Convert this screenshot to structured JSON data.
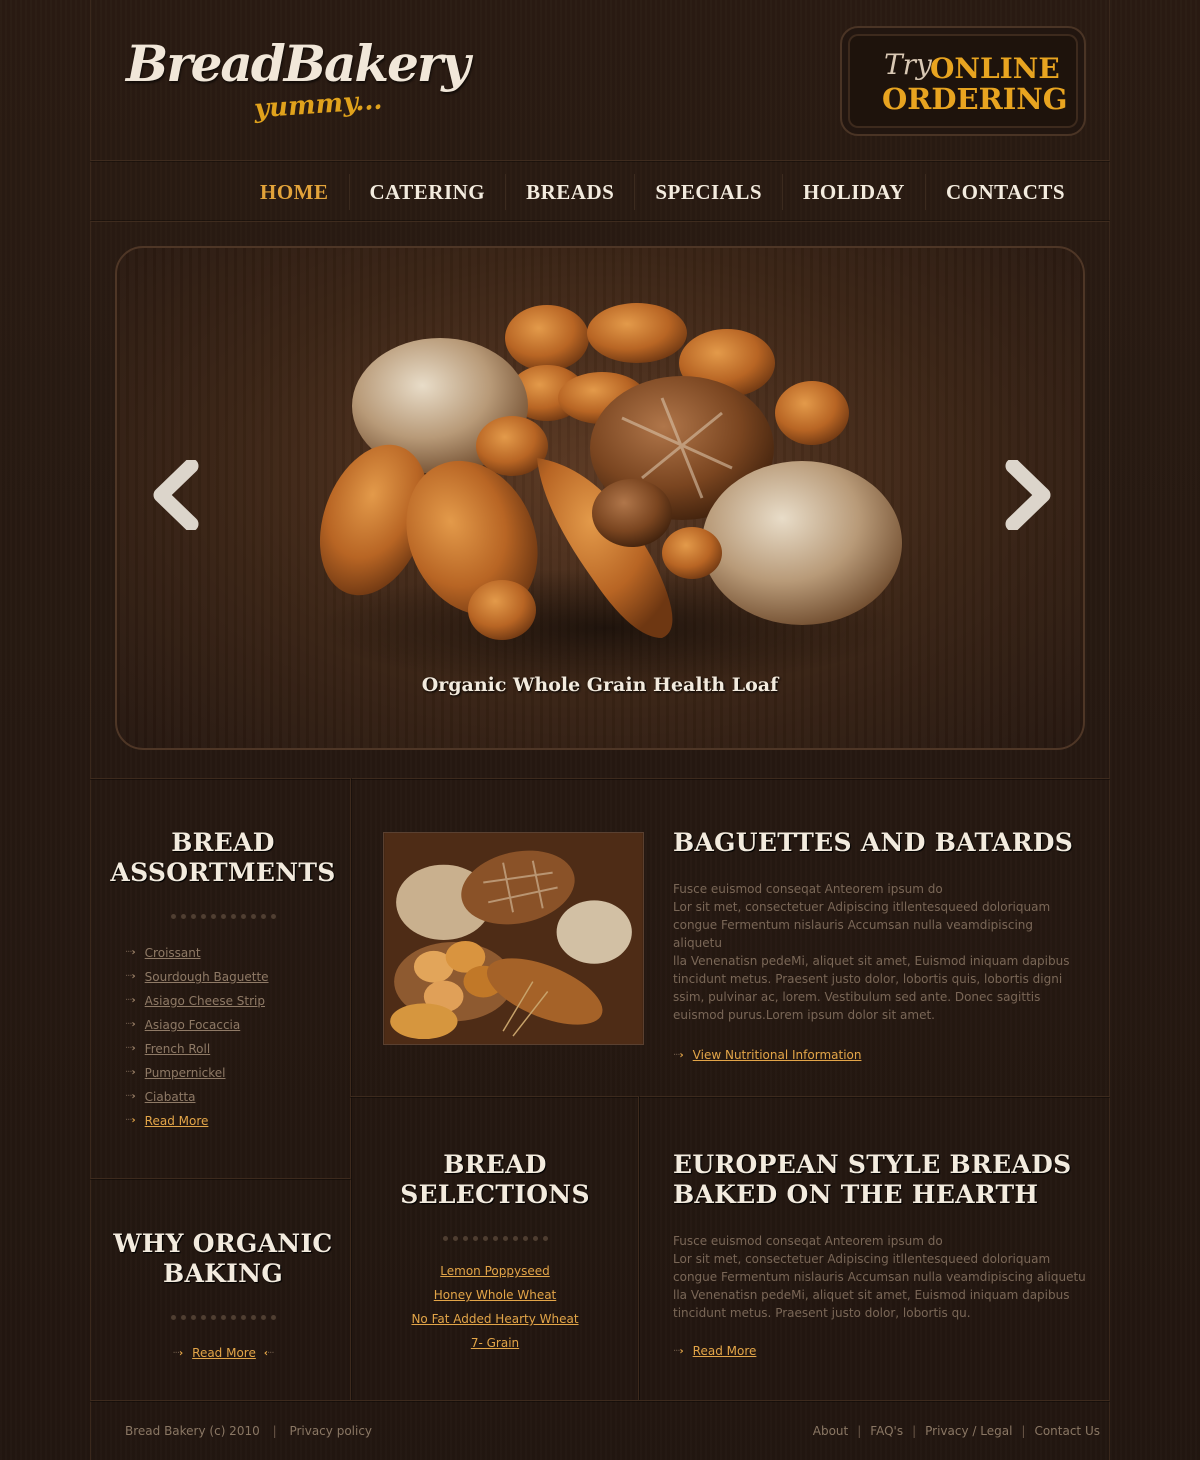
{
  "header": {
    "logo_main": "BreadBakery",
    "logo_sub": "yummy...",
    "order_try": "Try",
    "order_line1": "ONLINE",
    "order_line2": "ORDERING"
  },
  "nav": {
    "items": [
      {
        "label": "HOME",
        "active": true
      },
      {
        "label": "CATERING"
      },
      {
        "label": "BREADS"
      },
      {
        "label": "SPECIALS"
      },
      {
        "label": "HOLIDAY"
      },
      {
        "label": "CONTACTS"
      }
    ]
  },
  "slider": {
    "caption": "Organic Whole Grain Health Loaf"
  },
  "assortments": {
    "title_line1": "BREAD",
    "title_line2": "ASSORTMENTS",
    "items": [
      "Croissant",
      "Sourdough Baguette",
      "Asiago Cheese Strip",
      "Asiago Focaccia",
      "French Roll",
      "Pumpernickel",
      "Ciabatta"
    ],
    "read_more": "Read More"
  },
  "baguettes": {
    "title": "BAGUETTES AND BATARDS",
    "text_lines": [
      "Fusce euismod conseqat Anteorem ipsum do",
      "Lor sit met, consectetuer Adipiscing itllentesqueed doloriquam",
      "congue Fermentum nislauris Accumsan nulla veamdipiscing aliquetu",
      "lla Venenatisn pedeMi, aliquet sit amet, Euismod iniquam dapibus",
      "tincidunt metus. Praesent justo dolor, lobortis quis, lobortis digni",
      "ssim, pulvinar ac, lorem. Vestibulum sed ante. Donec sagittis",
      "euismod purus.Lorem ipsum dolor sit amet."
    ],
    "link": "View Nutritional Information"
  },
  "organic": {
    "title_line1": "WHY ORGANIC",
    "title_line2": "BAKING",
    "read_more": "Read More"
  },
  "selections": {
    "title_line1": "BREAD",
    "title_line2": "SELECTIONS",
    "items": [
      "Lemon Poppyseed",
      "Honey Whole Wheat",
      "No Fat Added Hearty Wheat ",
      "7- Grain"
    ]
  },
  "european": {
    "title_line1": "EUROPEAN STYLE BREADS",
    "title_line2": "BAKED ON THE HEARTH",
    "text_lines": [
      "Fusce euismod conseqat Anteorem ipsum do",
      "Lor sit met, consectetuer Adipiscing itllentesqueed doloriquam",
      "congue Fermentum nislauris Accumsan nulla veamdipiscing aliquetu",
      "lla Venenatisn pedeMi, aliquet sit amet, Euismod iniquam dapibus",
      "tincidunt metus. Praesent justo dolor, lobortis qu."
    ],
    "read_more": "Read More"
  },
  "footer": {
    "copyright": "Bread Bakery (c) 2010",
    "privacy": "Privacy policy",
    "links": [
      "About",
      "FAQ's",
      "Privacy / Legal",
      "Contact Us"
    ]
  },
  "colors": {
    "background": "#241710",
    "accent": "#e2a33a",
    "heading": "#f3ebde",
    "body_text": "#7a6757"
  },
  "icons": [
    "chevron-left-icon",
    "chevron-right-icon",
    "arrow-bullet-icon"
  ]
}
